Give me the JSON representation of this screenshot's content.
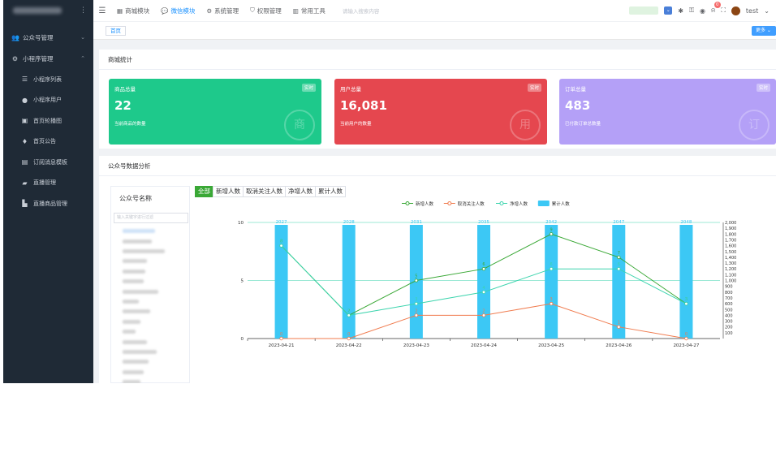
{
  "sidebar": {
    "groups": [
      {
        "label": "公众号管理",
        "icon": "user-group-icon"
      },
      {
        "label": "小程序管理",
        "icon": "mini-program-icon"
      }
    ],
    "items": [
      {
        "label": "小程序列表",
        "icon": "menu-icon"
      },
      {
        "label": "小程序用户",
        "icon": "user-icon"
      },
      {
        "label": "首页轮播图",
        "icon": "image-icon"
      },
      {
        "label": "首页公告",
        "icon": "bell-icon"
      },
      {
        "label": "订阅消息模板",
        "icon": "message-icon"
      },
      {
        "label": "直播管理",
        "icon": "live-icon"
      },
      {
        "label": "直播商品管理",
        "icon": "shop-icon"
      }
    ]
  },
  "topbar": {
    "tabs": [
      {
        "label": "商城模块",
        "icon": "store-icon"
      },
      {
        "label": "微信模块",
        "icon": "wechat-icon",
        "active": true
      },
      {
        "label": "系统管理",
        "icon": "gear-icon"
      },
      {
        "label": "权限管理",
        "icon": "shield-icon"
      },
      {
        "label": "常用工具",
        "icon": "tools-icon"
      }
    ],
    "search_placeholder": "请输入搜索内容",
    "badge_count": "0",
    "username": "test"
  },
  "tags": {
    "home": "首页",
    "more": "更多"
  },
  "stats": {
    "title": "商城统计",
    "cards": [
      {
        "label": "商品总量",
        "tag": "实时",
        "value": "22",
        "sub": "当前商品的数量",
        "seal": "商",
        "color": "#1ec98b"
      },
      {
        "label": "用户总量",
        "tag": "实时",
        "value": "16,081",
        "sub": "当前用户的数量",
        "seal": "用",
        "color": "#e5474f"
      },
      {
        "label": "订单总量",
        "tag": "实时",
        "value": "483",
        "sub": "已付款订单总数量",
        "seal": "订",
        "color": "#b4a0f7"
      }
    ]
  },
  "analysis": {
    "title": "公众号数据分析",
    "list_title": "公众号名称",
    "search_placeholder": "输入关键字进行过滤",
    "tabs": [
      "全部",
      "新增人数",
      "取消关注人数",
      "净增人数",
      "累计人数"
    ]
  },
  "chart_data": {
    "type": "bar",
    "categories": [
      "2023-04-21",
      "2023-04-22",
      "2023-04-23",
      "2023-04-24",
      "2023-04-25",
      "2023-04-26",
      "2023-04-27"
    ],
    "series": [
      {
        "name": "新增人数",
        "type": "line",
        "axis": "left",
        "color": "#3aa836",
        "values": [
          8,
          2,
          5,
          6,
          9,
          7,
          3
        ]
      },
      {
        "name": "取消关注人数",
        "type": "line",
        "axis": "left",
        "color": "#f07b4e",
        "values": [
          0,
          0,
          2,
          2,
          3,
          1,
          0
        ]
      },
      {
        "name": "净增人数",
        "type": "line",
        "axis": "left",
        "color": "#3bd4ad",
        "values": [
          8,
          2,
          3,
          4,
          6,
          6,
          3
        ]
      },
      {
        "name": "累计人数",
        "type": "bar",
        "axis": "right",
        "color": "#3cc8f5",
        "values": [
          2027,
          2028,
          2031,
          2035,
          2042,
          2047,
          2048
        ]
      }
    ],
    "bar_labels": [
      "2027",
      "2028",
      "2031",
      "2035",
      "2042",
      "2047",
      "2048"
    ],
    "y_left": {
      "ticks": [
        "0",
        "5",
        "10"
      ],
      "range": [
        0,
        10
      ]
    },
    "y_right": {
      "range": [
        0,
        2000
      ],
      "ticks": [
        "100",
        "200",
        "300",
        "400",
        "500",
        "600",
        "700",
        "800",
        "900",
        "1,000",
        "1,100",
        "1,200",
        "1,300",
        "1,400",
        "1,500",
        "1,600",
        "1,700",
        "1,800",
        "1,900",
        "2,000"
      ]
    },
    "legend_position": "top-center",
    "grid": true
  }
}
